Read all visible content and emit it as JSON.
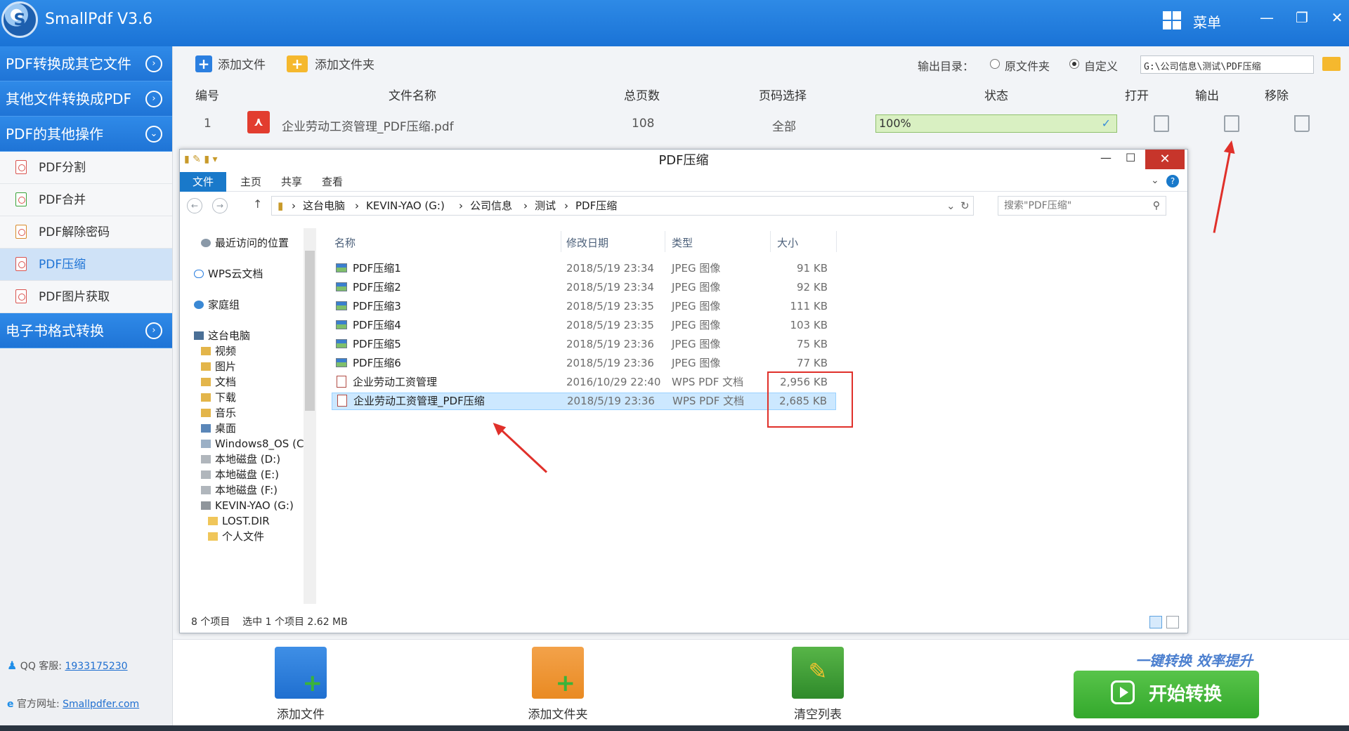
{
  "app": {
    "title": "SmallPdf V3.6",
    "menu_label": "菜单",
    "logo_letter": "S"
  },
  "sidebar": {
    "categories": [
      {
        "label": "PDF转换成其它文件"
      },
      {
        "label": "其他文件转换成PDF"
      },
      {
        "label": "PDF的其他操作"
      },
      {
        "label": "电子书格式转换"
      }
    ],
    "sub_items": [
      {
        "label": "PDF分割"
      },
      {
        "label": "PDF合并"
      },
      {
        "label": "PDF解除密码"
      },
      {
        "label": "PDF压缩"
      },
      {
        "label": "PDF图片获取"
      }
    ],
    "qq_label": "QQ 客服:",
    "qq_number": "1933175230",
    "site_label": "官方网址:",
    "site_url": "Smallpdfer.com"
  },
  "toolbar": {
    "add_file": "添加文件",
    "add_folder": "添加文件夹",
    "output_dir_label": "输出目录：",
    "radio_original": "原文件夹",
    "radio_custom": "自定义",
    "output_path": "G:\\公司信息\\测试\\PDF压缩"
  },
  "table": {
    "headers": {
      "num": "编号",
      "name": "文件名称",
      "pages": "总页数",
      "page_sel": "页码选择",
      "status": "状态",
      "open": "打开",
      "output": "输出",
      "remove": "移除"
    },
    "rows": [
      {
        "num": "1",
        "name": "企业劳动工资管理_PDF压缩.pdf",
        "pages": "108",
        "page_sel": "全部",
        "status": "100%",
        "progress": 1.0
      }
    ]
  },
  "explorer": {
    "title": "PDF压缩",
    "ribbon": {
      "file": "文件",
      "home": "主页",
      "share": "共享",
      "view": "查看"
    },
    "breadcrumb": [
      "这台电脑",
      "KEVIN-YAO (G:)",
      "公司信息",
      "测试",
      "PDF压缩"
    ],
    "search_placeholder": "搜索\"PDF压缩\"",
    "nav": [
      "最近访问的位置",
      "WPS云文档",
      "家庭组",
      "这台电脑",
      "视频",
      "图片",
      "文档",
      "下载",
      "音乐",
      "桌面",
      "Windows8_OS (C",
      "本地磁盘 (D:)",
      "本地磁盘 (E:)",
      "本地磁盘 (F:)",
      "KEVIN-YAO (G:)",
      "LOST.DIR",
      "个人文件"
    ],
    "columns": {
      "name": "名称",
      "date": "修改日期",
      "type": "类型",
      "size": "大小"
    },
    "files": [
      {
        "name": "PDF压缩1",
        "date": "2018/5/19 23:34",
        "type": "JPEG 图像",
        "size": "91 KB",
        "kind": "jpg"
      },
      {
        "name": "PDF压缩2",
        "date": "2018/5/19 23:34",
        "type": "JPEG 图像",
        "size": "92 KB",
        "kind": "jpg"
      },
      {
        "name": "PDF压缩3",
        "date": "2018/5/19 23:35",
        "type": "JPEG 图像",
        "size": "111 KB",
        "kind": "jpg"
      },
      {
        "name": "PDF压缩4",
        "date": "2018/5/19 23:35",
        "type": "JPEG 图像",
        "size": "103 KB",
        "kind": "jpg"
      },
      {
        "name": "PDF压缩5",
        "date": "2018/5/19 23:36",
        "type": "JPEG 图像",
        "size": "75 KB",
        "kind": "jpg"
      },
      {
        "name": "PDF压缩6",
        "date": "2018/5/19 23:36",
        "type": "JPEG 图像",
        "size": "77 KB",
        "kind": "jpg"
      },
      {
        "name": "企业劳动工资管理",
        "date": "2016/10/29 22:40",
        "type": "WPS PDF 文档",
        "size": "2,956 KB",
        "kind": "pdf"
      },
      {
        "name": "企业劳动工资管理_PDF压缩",
        "date": "2018/5/19 23:36",
        "type": "WPS PDF 文档",
        "size": "2,685 KB",
        "kind": "pdf",
        "selected": true
      }
    ],
    "status": {
      "count": "8 个项目",
      "selected": "选中 1 个项目  2.62 MB"
    }
  },
  "bottom": {
    "add_file": "添加文件",
    "add_folder": "添加文件夹",
    "clear_list": "清空列表",
    "slogan": "一键转换  效率提升",
    "start": "开始转换"
  },
  "colors": {
    "accent": "#1f74d6",
    "start_green": "#3bb032",
    "annotation_red": "#e0302a"
  }
}
